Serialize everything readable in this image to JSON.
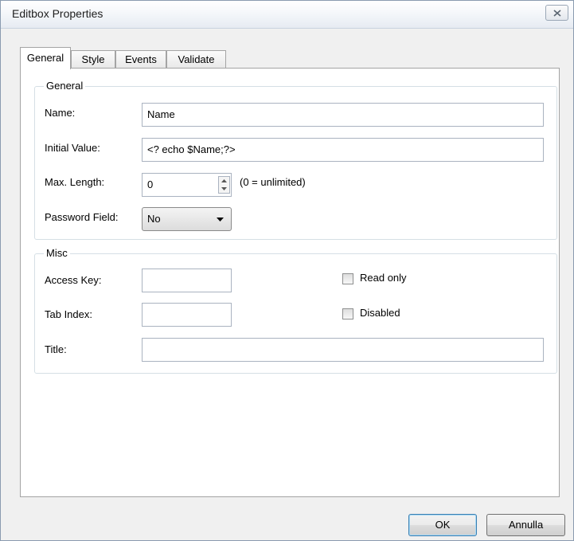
{
  "window": {
    "title": "Editbox Properties"
  },
  "tabs": [
    {
      "label": "General",
      "active": true
    },
    {
      "label": "Style",
      "active": false
    },
    {
      "label": "Events",
      "active": false
    },
    {
      "label": "Validate",
      "active": false
    }
  ],
  "general_group": {
    "title": "General",
    "name_label": "Name:",
    "name_value": "Name",
    "initial_label": "Initial Value:",
    "initial_value": "<? echo $Name;?>",
    "maxlen_label": "Max. Length:",
    "maxlen_value": "0",
    "maxlen_hint": "(0 = unlimited)",
    "password_label": "Password Field:",
    "password_value": "No"
  },
  "misc_group": {
    "title": "Misc",
    "access_label": "Access Key:",
    "access_value": "",
    "tabindex_label": "Tab Index:",
    "tabindex_value": "",
    "title_label": "Title:",
    "title_value": "",
    "readonly_label": "Read only",
    "readonly_checked": false,
    "disabled_label": "Disabled",
    "disabled_checked": false
  },
  "buttons": {
    "ok": "OK",
    "cancel": "Annulla"
  }
}
